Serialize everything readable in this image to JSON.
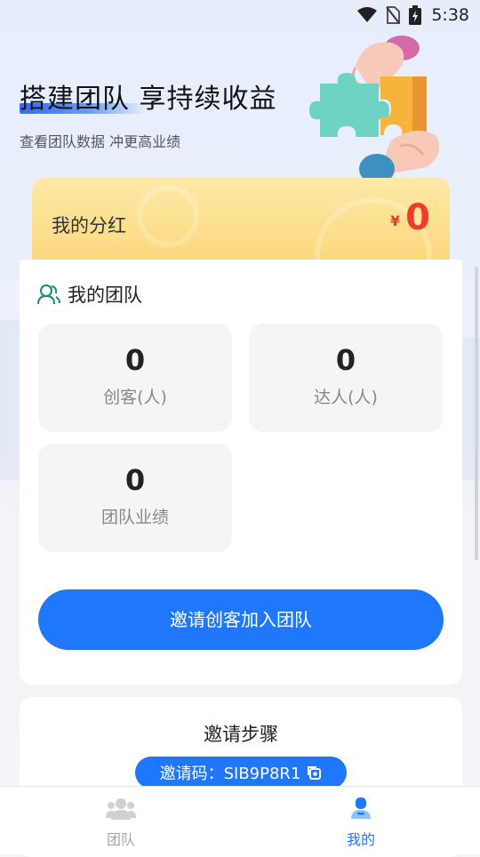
{
  "status_bar": {
    "time": "5:38"
  },
  "hero": {
    "title": "搭建团队 享持续收益",
    "subtitle": "查看团队数据 冲更高业绩"
  },
  "dividend": {
    "label": "我的分红",
    "currency": "¥",
    "amount": "0"
  },
  "team": {
    "title": "我的团队",
    "stats": [
      {
        "value": "0",
        "label": "创客(人)"
      },
      {
        "value": "0",
        "label": "达人(人)"
      },
      {
        "value": "0",
        "label": "团队业绩"
      }
    ],
    "invite_button": "邀请创客加入团队"
  },
  "steps": {
    "title": "邀请步骤",
    "invite_code": "邀请码：SIB9P8R1"
  },
  "bottom_nav": [
    {
      "label": "团队",
      "icon": "team-icon",
      "active": false
    },
    {
      "label": "我的",
      "icon": "profile-icon",
      "active": true
    }
  ],
  "colors": {
    "accent": "#1f77fb",
    "amount": "#f13a2a",
    "card_gold": "#fbd77a"
  }
}
